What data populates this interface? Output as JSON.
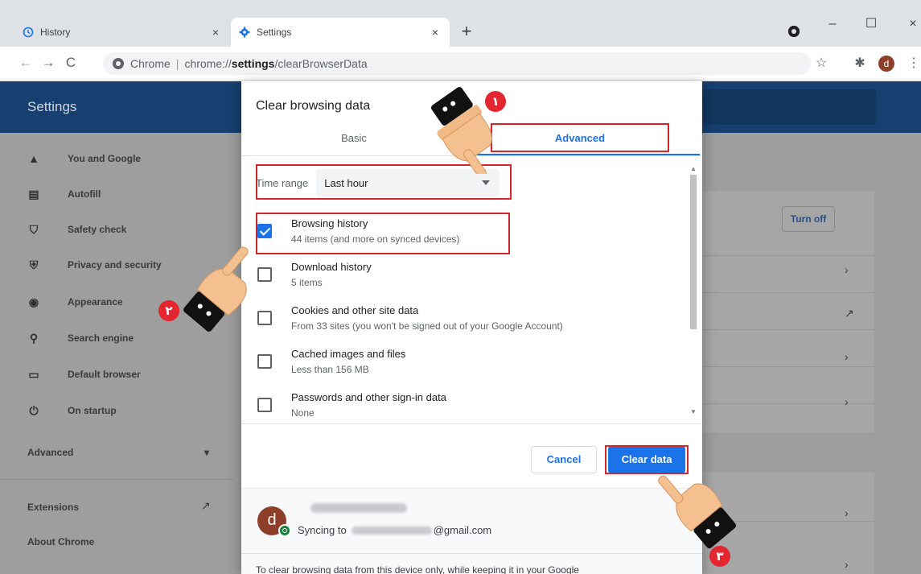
{
  "tabs": [
    {
      "title": "History",
      "icon": "history-icon",
      "close": "×"
    },
    {
      "title": "Settings",
      "icon": "gear-icon",
      "close": "×"
    }
  ],
  "new_tab": "+",
  "window": {
    "minimize": "–",
    "maximize": "☐",
    "close": "×"
  },
  "toolbar": {
    "back": "←",
    "forward": "→",
    "reload": "C",
    "site_label": "Chrome",
    "url_prefix": "chrome://",
    "url_bold": "settings",
    "url_rest": "/clearBrowserData",
    "star": "☆",
    "extensions": "✱",
    "avatar_letter": "d",
    "menu": "⋮"
  },
  "settings_page": {
    "title": "Settings",
    "sidebar": [
      {
        "label": "You and Google",
        "icon": "person-icon",
        "glyph": "👤"
      },
      {
        "label": "Autofill",
        "icon": "clipboard-icon",
        "glyph": "▤"
      },
      {
        "label": "Safety check",
        "icon": "shield-check-icon",
        "glyph": "⛉"
      },
      {
        "label": "Privacy and security",
        "icon": "shield-icon",
        "glyph": "⛨"
      },
      {
        "label": "Appearance",
        "icon": "palette-icon",
        "glyph": "◉"
      },
      {
        "label": "Search engine",
        "icon": "search-icon",
        "glyph": "⚲"
      },
      {
        "label": "Default browser",
        "icon": "browser-icon",
        "glyph": "▭"
      },
      {
        "label": "On startup",
        "icon": "power-icon",
        "glyph": "⏻"
      }
    ],
    "advanced": "Advanced",
    "advanced_chevron": "▾",
    "extensions": "Extensions",
    "extensions_icon": "↗",
    "about": "About Chrome",
    "turn_off": "Turn off",
    "row_arrow": "›",
    "row_external": "↗"
  },
  "dialog": {
    "title": "Clear browsing data",
    "tab_basic": "Basic",
    "tab_advanced": "Advanced",
    "time_range_label": "Time range",
    "time_range_value": "Last hour",
    "options": [
      {
        "title": "Browsing history",
        "subtitle": "44 items (and more on synced devices)",
        "checked": true
      },
      {
        "title": "Download history",
        "subtitle": "5 items",
        "checked": false
      },
      {
        "title": "Cookies and other site data",
        "subtitle": "From 33 sites (you won't be signed out of your Google Account)",
        "checked": false
      },
      {
        "title": "Cached images and files",
        "subtitle": "Less than 156 MB",
        "checked": false
      },
      {
        "title": "Passwords and other sign-in data",
        "subtitle": "None",
        "checked": false
      }
    ],
    "cancel": "Cancel",
    "clear": "Clear data",
    "sync": {
      "avatar_letter": "d",
      "syncing_prefix": "Syncing to",
      "email_suffix": "@gmail.com",
      "note": "To clear browsing data from this device only, while keeping it in your Google"
    }
  },
  "annotations": [
    "١",
    "٢",
    "٣"
  ]
}
